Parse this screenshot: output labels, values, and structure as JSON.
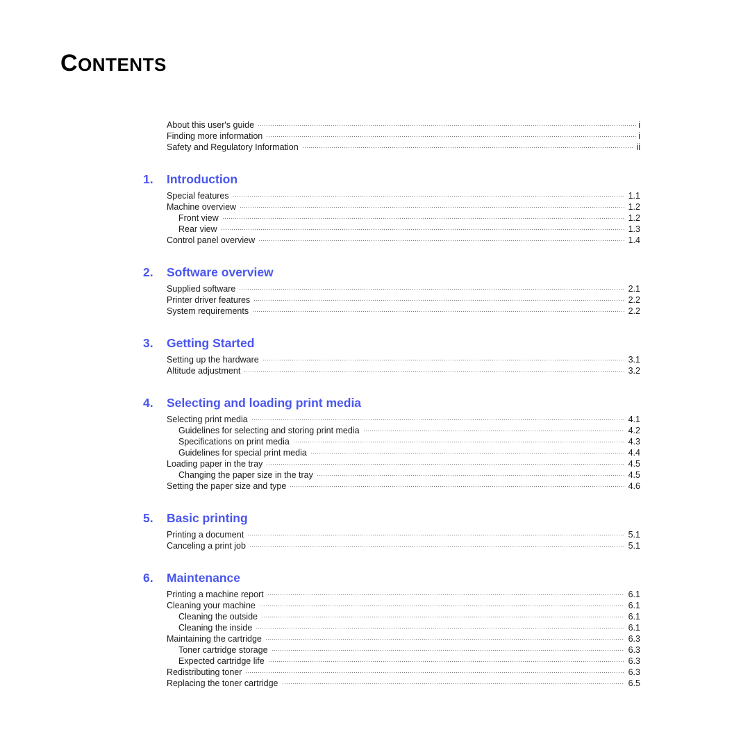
{
  "document": {
    "title": "CONTENTS",
    "title_first_letter": "C",
    "title_rest": "ONTENTS",
    "heading_color": "#4a56ee",
    "body_color": "#1a1a1a",
    "leader_color": "#7a7a7a"
  },
  "preamble": {
    "entries": [
      {
        "label": "About this user's guide",
        "page": "i",
        "level": 1
      },
      {
        "label": "Finding more information",
        "page": "i",
        "level": 1
      },
      {
        "label": "Safety and Regulatory Information",
        "page": "ii",
        "level": 1
      }
    ]
  },
  "chapters": [
    {
      "number": "1.",
      "title": "Introduction",
      "entries": [
        {
          "label": "Special features",
          "page": "1.1",
          "level": 1
        },
        {
          "label": "Machine overview",
          "page": "1.2",
          "level": 1
        },
        {
          "label": "Front view",
          "page": "1.2",
          "level": 2
        },
        {
          "label": "Rear view",
          "page": "1.3",
          "level": 2
        },
        {
          "label": "Control panel overview",
          "page": "1.4",
          "level": 1
        }
      ]
    },
    {
      "number": "2.",
      "title": "Software overview",
      "entries": [
        {
          "label": "Supplied software",
          "page": "2.1",
          "level": 1
        },
        {
          "label": "Printer driver features",
          "page": "2.2",
          "level": 1
        },
        {
          "label": "System requirements",
          "page": "2.2",
          "level": 1
        }
      ]
    },
    {
      "number": "3.",
      "title": "Getting Started",
      "entries": [
        {
          "label": "Setting up the hardware",
          "page": "3.1",
          "level": 1
        },
        {
          "label": "Altitude adjustment",
          "page": "3.2",
          "level": 1
        }
      ]
    },
    {
      "number": "4.",
      "title": "Selecting and loading print media",
      "entries": [
        {
          "label": "Selecting print media",
          "page": "4.1",
          "level": 1
        },
        {
          "label": "Guidelines for selecting and storing print media",
          "page": "4.2",
          "level": 2
        },
        {
          "label": "Specifications on print media",
          "page": "4.3",
          "level": 2
        },
        {
          "label": "Guidelines for special print media",
          "page": "4.4",
          "level": 2
        },
        {
          "label": "Loading paper in the tray",
          "page": "4.5",
          "level": 1
        },
        {
          "label": "Changing the paper size in the tray",
          "page": "4.5",
          "level": 2
        },
        {
          "label": "Setting the paper size and type",
          "page": "4.6",
          "level": 1
        }
      ]
    },
    {
      "number": "5.",
      "title": "Basic printing",
      "entries": [
        {
          "label": "Printing a document",
          "page": "5.1",
          "level": 1
        },
        {
          "label": "Canceling a print job",
          "page": "5.1",
          "level": 1
        }
      ]
    },
    {
      "number": "6.",
      "title": "Maintenance",
      "entries": [
        {
          "label": "Printing a machine report",
          "page": "6.1",
          "level": 1
        },
        {
          "label": "Cleaning your machine",
          "page": "6.1",
          "level": 1
        },
        {
          "label": "Cleaning the outside",
          "page": "6.1",
          "level": 2
        },
        {
          "label": "Cleaning the inside",
          "page": "6.1",
          "level": 2
        },
        {
          "label": "Maintaining the cartridge",
          "page": "6.3",
          "level": 1
        },
        {
          "label": "Toner cartridge storage",
          "page": "6.3",
          "level": 2
        },
        {
          "label": "Expected cartridge life",
          "page": "6.3",
          "level": 2
        },
        {
          "label": "Redistributing toner",
          "page": "6.3",
          "level": 1
        },
        {
          "label": "Replacing the toner cartridge",
          "page": "6.5",
          "level": 1
        }
      ]
    }
  ]
}
